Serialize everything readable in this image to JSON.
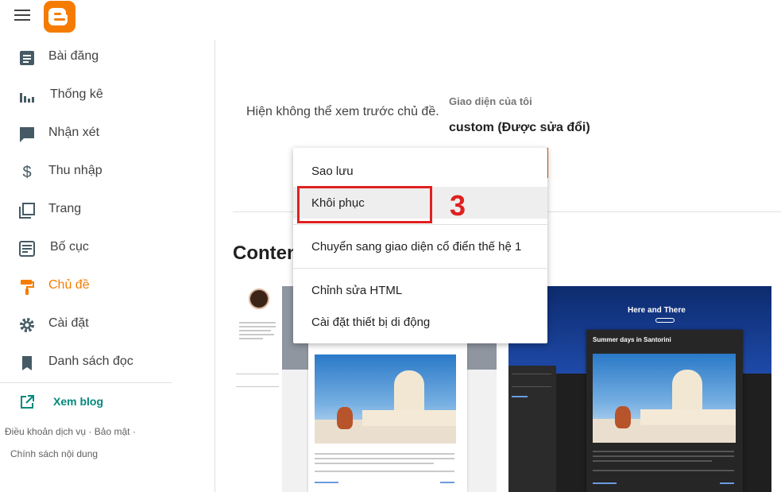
{
  "sidebar": {
    "items": [
      {
        "label": "Bài đăng",
        "icon": "posts-icon"
      },
      {
        "label": "Thống kê",
        "icon": "stats-icon"
      },
      {
        "label": "Nhận xét",
        "icon": "comments-icon"
      },
      {
        "label": "Thu nhập",
        "icon": "dollar-icon"
      },
      {
        "label": "Trang",
        "icon": "pages-icon"
      },
      {
        "label": "Bố cục",
        "icon": "layout-icon"
      },
      {
        "label": "Chủ đề",
        "icon": "paint-roller-icon",
        "active": true
      },
      {
        "label": "Cài đặt",
        "icon": "gear-icon"
      },
      {
        "label": "Danh sách đọc",
        "icon": "bookmark-icon"
      }
    ],
    "view_blog": "Xem blog",
    "footer": {
      "terms": "Điều khoản dịch vụ",
      "sep1": "·",
      "privacy": "Bảo mật",
      "sep2": "·",
      "content_policy": "Chính sách nội dung"
    }
  },
  "main": {
    "preview_message": "Hiện không thể xem trước chủ đề.",
    "my_theme_label": "Giao diện của tôi",
    "theme_name": "custom (Được sửa đổi)",
    "section_title": "Conten"
  },
  "thumbnails": {
    "theme2_blog_title": "Here and There",
    "theme2_post_title": "Summer days in Santorini"
  },
  "menu": {
    "items": [
      "Sao lưu",
      "Khôi phục",
      "Chuyển sang giao diện cổ điển thế hệ 1",
      "Chỉnh sửa HTML",
      "Cài đặt thiết bị di động"
    ]
  },
  "annotation": {
    "step_number": "3"
  },
  "colors": {
    "accent": "#f57c00",
    "link": "#00897b",
    "annotation": "#e02020"
  }
}
